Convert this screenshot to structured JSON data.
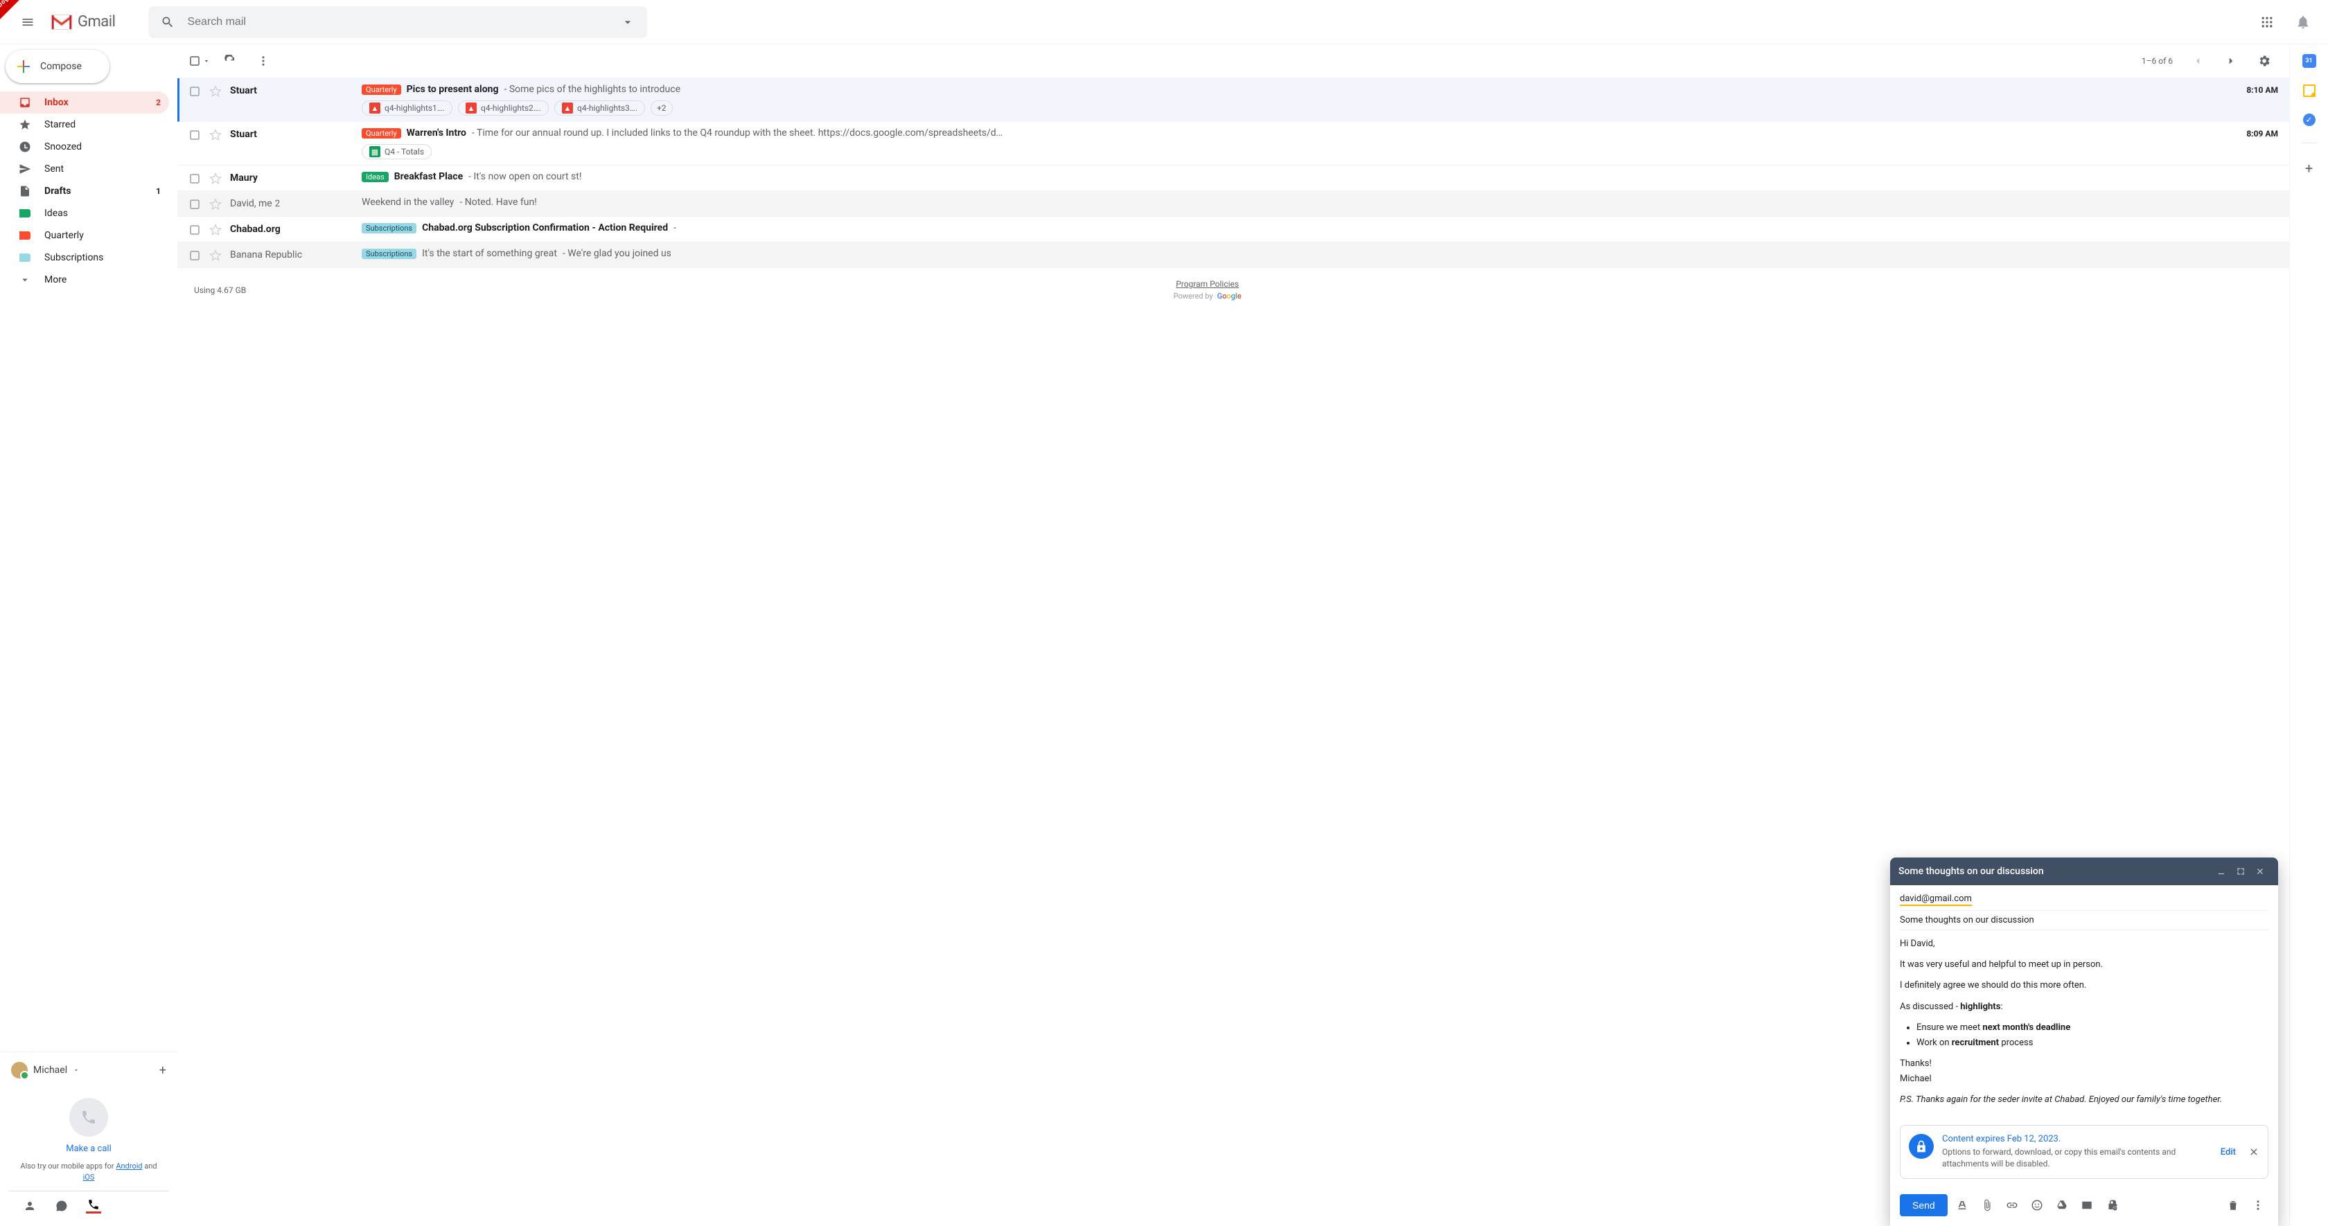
{
  "dogfood_label": "Dogfood",
  "logo_text": "Gmail",
  "search": {
    "placeholder": "Search mail"
  },
  "compose_label": "Compose",
  "nav": {
    "inbox": {
      "label": "Inbox",
      "count": "2"
    },
    "starred": {
      "label": "Starred"
    },
    "snoozed": {
      "label": "Snoozed"
    },
    "sent": {
      "label": "Sent"
    },
    "drafts": {
      "label": "Drafts",
      "count": "1"
    },
    "ideas": {
      "label": "Ideas"
    },
    "quarterly": {
      "label": "Quarterly"
    },
    "subscriptions": {
      "label": "Subscriptions"
    },
    "more": {
      "label": "More"
    }
  },
  "hangouts": {
    "name": "Michael",
    "make_call": "Make a call",
    "mobile_pre": "Also try our mobile apps for ",
    "android": "Android",
    "and": " and ",
    "ios": "iOS"
  },
  "toolbar": {
    "range": "1–6 of 6"
  },
  "rows": [
    {
      "sender": "Stuart",
      "tag": "Quarterly",
      "subject": "Pics to present along",
      "snippet": " - Some pics of the highlights to introduce",
      "time": "8:10 AM",
      "att1": "q4-highlights1….",
      "att2": "q4-highlights2….",
      "att3": "q4-highlights3….",
      "more": "+2"
    },
    {
      "sender": "Stuart",
      "tag": "Quarterly",
      "subject": "Warren's Intro",
      "snippet": " - Time for our annual round up. I included links to the Q4 roundup with the sheet. https://docs.google.com/spreadsheets/d…",
      "time": "8:09 AM",
      "att1": "Q4 - Totals"
    },
    {
      "sender": "Maury",
      "tag": "Ideas",
      "subject": "Breakfast Place",
      "snippet": " - It's now open on court st!",
      "time": ""
    },
    {
      "sender": "David, me",
      "sender_count": "2",
      "subject": "Weekend in the valley",
      "snippet": " - Noted. Have fun!",
      "time": ""
    },
    {
      "sender": "Chabad.org",
      "tag": "Subscriptions",
      "subject": "Chabad.org Subscription Confirmation - Action Required",
      "snippet": " - ",
      "time": ""
    },
    {
      "sender": "Banana Republic",
      "tag": "Subscriptions",
      "subject": "It's the start of something great",
      "snippet": " - We're glad you joined us",
      "time": ""
    }
  ],
  "footer": {
    "storage": "Using 4.67 GB",
    "policies": "Program Policies",
    "powered": "Powered by"
  },
  "compose_window": {
    "title": "Some thoughts on our discussion",
    "recipient": "david@gmail.com",
    "subject": "Some thoughts on our discussion",
    "greeting": "Hi David,",
    "p1": "It was very useful and helpful to meet up in person.",
    "p2": "I definitely agree we should do this more often.",
    "p3_pre": "As discussed - ",
    "p3_bold": "highlights",
    "p3_post": ":",
    "li1_pre": "Ensure we meet ",
    "li1_bold": "next month's deadline",
    "li2_pre": "Work on ",
    "li2_bold": "recruitment",
    "li2_post": " process",
    "thanks": "Thanks!",
    "sig": "Michael",
    "ps": "P.S. Thanks again for the seder invite at Chabad. Enjoyed our family's time together.",
    "expire_title": "Content expires Feb 12, 2023.",
    "expire_desc": "Options to forward, download, or copy this email's contents and attachments will be disabled.",
    "edit": "Edit",
    "send": "Send"
  }
}
